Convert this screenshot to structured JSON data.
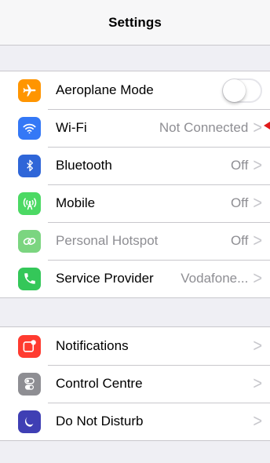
{
  "header": {
    "title": "Settings"
  },
  "colors": {
    "airplane": "#ff9500",
    "wifi": "#3478f6",
    "bluetooth": "#2f66d8",
    "mobile": "#4cd964",
    "hotspot": "#7bd580",
    "phone": "#34c759",
    "notifications": "#ff3b30",
    "control_centre": "#8e8e93",
    "dnd": "#3f3fb4",
    "pointer": "#e01b1b"
  },
  "group1": [
    {
      "name": "Aeroplane Mode",
      "icon": "airplane-icon",
      "toggle": false
    },
    {
      "name": "Wi-Fi",
      "icon": "wifi-icon",
      "value": "Not Connected"
    },
    {
      "name": "Bluetooth",
      "icon": "bluetooth-icon",
      "value": "Off"
    },
    {
      "name": "Mobile",
      "icon": "antenna-icon",
      "value": "Off"
    },
    {
      "name": "Personal Hotspot",
      "icon": "hotspot-icon",
      "value": "Off"
    },
    {
      "name": "Service Provider",
      "icon": "phone-icon",
      "value": "Vodafone..."
    }
  ],
  "group2": [
    {
      "name": "Notifications",
      "icon": "notifications-icon"
    },
    {
      "name": "Control Centre",
      "icon": "control-centre-icon"
    },
    {
      "name": "Do Not Disturb",
      "icon": "moon-icon"
    }
  ]
}
